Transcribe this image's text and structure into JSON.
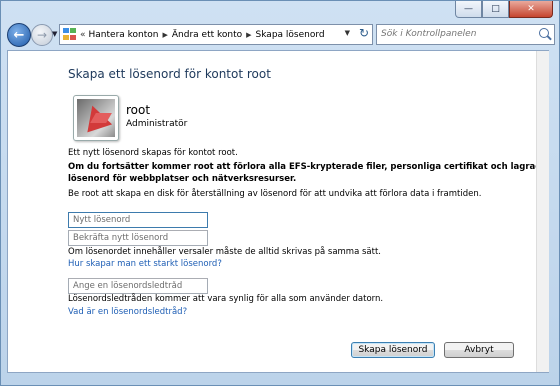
{
  "window": {
    "caption_buttons": [
      "minimize",
      "maximize",
      "close"
    ]
  },
  "navbar": {
    "breadcrumbs": [
      "Hantera konton",
      "Ändra ett konto",
      "Skapa lösenord"
    ],
    "search_placeholder": "Sök i Kontrollpanelen"
  },
  "content": {
    "title": "Skapa ett lösenord för kontot root",
    "user": {
      "name": "root",
      "role": "Administratör"
    },
    "info": "Ett nytt lösenord skapas för kontot root.",
    "warning_line1": "Om du fortsätter kommer root att förlora alla EFS-krypterade filer, personliga certifikat och lagrade",
    "warning_line2": "lösenord för webbplatser och nätverksresurser.",
    "advice": "Be root att skapa en disk för återställning av lösenord för att undvika att förlora data i framtiden.",
    "fields": {
      "new_password_placeholder": "Nytt lösenord",
      "confirm_password_placeholder": "Bekräfta nytt lösenord",
      "hint_placeholder": "Ange en lösenordsledtråd"
    },
    "case_note": "Om lösenordet innehåller versaler måste de alltid skrivas på samma sätt.",
    "strong_password_link": "Hur skapar man ett starkt lösenord?",
    "hint_note": "Lösenordsledtråden kommer att vara synlig för alla som använder datorn.",
    "hint_link": "Vad är en lösenordsledtråd?",
    "buttons": {
      "create": "Skapa lösenord",
      "cancel": "Avbryt"
    }
  }
}
